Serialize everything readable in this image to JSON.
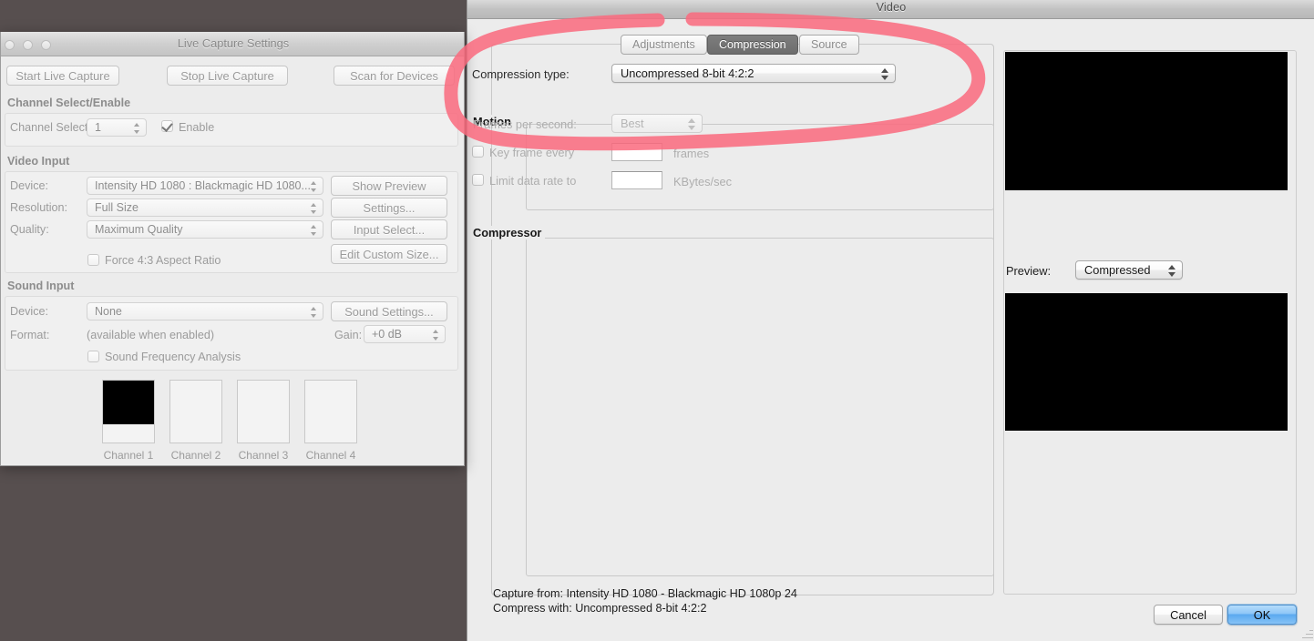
{
  "desktop": {
    "background_color": "#574f4f"
  },
  "video_dialog": {
    "title": "Video",
    "tabs": [
      {
        "label": "Adjustments",
        "selected": false
      },
      {
        "label": "Compression",
        "selected": true
      },
      {
        "label": "Source",
        "selected": false
      }
    ],
    "compression_type": {
      "label": "Compression type:",
      "value": "Uncompressed 8-bit 4:2:2"
    },
    "motion": {
      "group_label": "Motion",
      "frames_per_second_label": "Frames per second:",
      "frames_per_second_value": "Best",
      "key_frame_label": "Key frame every",
      "key_frame_value": "",
      "key_frame_unit": "frames",
      "key_frame_checked": false,
      "limit_data_rate_label": "Limit data rate to",
      "limit_data_rate_value": "",
      "limit_data_rate_unit": "KBytes/sec",
      "limit_data_rate_checked": false
    },
    "compressor": {
      "group_label": "Compressor"
    },
    "preview": {
      "label": "Preview:",
      "value": "Compressed"
    },
    "summary": {
      "capture_from": "Capture from: Intensity HD 1080 - Blackmagic HD 1080p 24",
      "compress_with": "Compress with: Uncompressed 8-bit 4:2:2"
    },
    "buttons": {
      "cancel": "Cancel",
      "ok": "OK"
    }
  },
  "live_capture_settings": {
    "title": "Live Capture Settings",
    "toolbar": {
      "start": "Start Live Capture",
      "stop": "Stop Live Capture",
      "scan": "Scan for Devices"
    },
    "channel_select_enable": {
      "section_title": "Channel Select/Enable",
      "channel_select_label": "Channel Select:",
      "channel_select_value": "1",
      "enable_label": "Enable",
      "enable_checked": true
    },
    "video_input": {
      "section_title": "Video Input",
      "device_label": "Device:",
      "device_value": "Intensity HD 1080 : Blackmagic HD 1080...",
      "resolution_label": "Resolution:",
      "resolution_value": "Full Size",
      "quality_label": "Quality:",
      "quality_value": "Maximum Quality",
      "force_aspect_label": "Force 4:3 Aspect Ratio",
      "force_aspect_checked": false,
      "show_preview_button": "Show Preview",
      "settings_button": "Settings...",
      "input_select_button": "Input Select...",
      "edit_custom_size_button": "Edit Custom Size..."
    },
    "sound_input": {
      "section_title": "Sound Input",
      "device_label": "Device:",
      "device_value": "None",
      "format_label": "Format:",
      "format_value": "(available when enabled)",
      "gain_label": "Gain:",
      "gain_value": "+0 dB",
      "sound_settings_button": "Sound Settings...",
      "sound_freq_label": "Sound Frequency Analysis",
      "sound_freq_checked": false
    },
    "channels": [
      {
        "caption": "Channel 1",
        "has_video": true
      },
      {
        "caption": "Channel 2",
        "has_video": false
      },
      {
        "caption": "Channel 3",
        "has_video": false
      },
      {
        "caption": "Channel 4",
        "has_video": false
      }
    ]
  },
  "annotation": {
    "type": "hand-drawn-ellipse-highlight",
    "color": "#fa6a7e"
  }
}
